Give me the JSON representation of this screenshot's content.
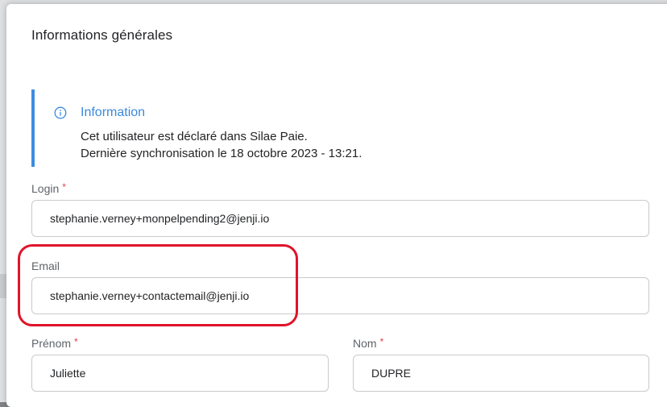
{
  "modal": {
    "title": "Informations générales"
  },
  "info": {
    "icon": "info-circle-icon",
    "heading": "Information",
    "line1": "Cet utilisateur est déclaré dans Silae Paie.",
    "line2": "Dernière synchronisation le 18 octobre 2023 - 13:21.",
    "accent_color": "#3d8ce0"
  },
  "form": {
    "login": {
      "label": "Login",
      "required_mark": "*",
      "value": "stephanie.verney+monpelpending2@jenji.io"
    },
    "email": {
      "label": "Email",
      "value": "stephanie.verney+contactemail@jenji.io"
    },
    "prenom": {
      "label": "Prénom",
      "required_mark": "*",
      "value": "Juliette"
    },
    "nom": {
      "label": "Nom",
      "required_mark": "*",
      "value": "DUPRE"
    }
  },
  "annotation": {
    "highlight_color": "#e0142a"
  }
}
